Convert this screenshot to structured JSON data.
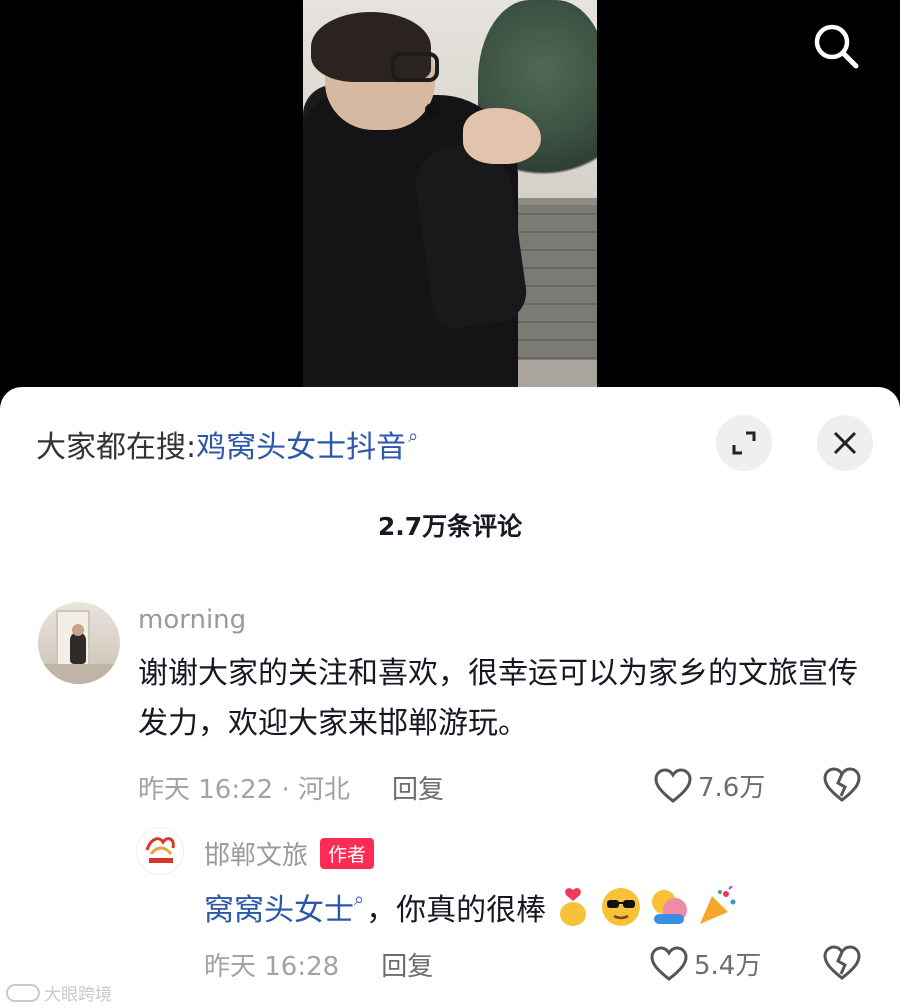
{
  "header": {
    "search_icon": "search-icon"
  },
  "panel": {
    "suggestion_prefix": "大家都在搜:",
    "suggestion_term": "鸡窝头女士抖音",
    "expand_icon": "expand-icon",
    "close_icon": "close-icon",
    "comment_count": "2.7万条评论"
  },
  "comments": [
    {
      "username": "morning",
      "text": "谢谢大家的关注和喜欢，很幸运可以为家乡的文旅宣传发力，欢迎大家来邯郸游玩。",
      "time_location": "昨天 16:22 · 河北",
      "reply_label": "回复",
      "likes": "7.6万"
    }
  ],
  "reply": {
    "username": "邯郸文旅",
    "badge": "作者",
    "mention": "窝窝头女士",
    "text": "，你真的很棒",
    "emojis": [
      "heart-hands-emoji",
      "cool-face-emoji",
      "hug-emoji",
      "party-popper-emoji"
    ],
    "time": "昨天 16:28",
    "reply_label": "回复",
    "likes": "5.4万"
  },
  "watermark": {
    "text": "大眼跨境"
  },
  "colors": {
    "link": "#2d57a8",
    "badge": "#fe2c55",
    "muted": "#a3a3a3",
    "text": "#161823"
  }
}
